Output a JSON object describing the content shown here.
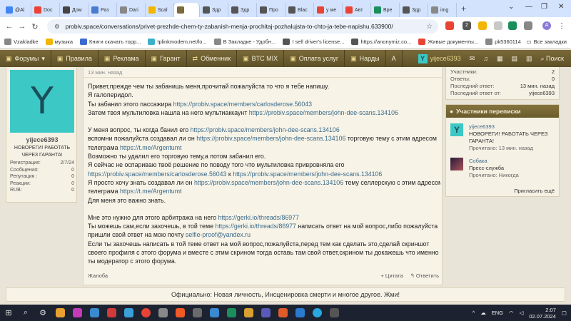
{
  "browser": {
    "tabs": [
      {
        "label": "@Al",
        "color": "#4285f4"
      },
      {
        "label": "Doc",
        "color": "#e94335"
      },
      {
        "label": "Дом",
        "color": "#444444"
      },
      {
        "label": "Раз",
        "color": "#4a7bd0"
      },
      {
        "label": "Dari",
        "color": "#888888"
      },
      {
        "label": "Scal",
        "color": "#f2b600"
      },
      {
        "label": "",
        "color": "#7a6a3a",
        "active": true
      },
      {
        "label": "Здр",
        "color": "#555555"
      },
      {
        "label": "Здр",
        "color": "#555555"
      },
      {
        "label": "Про",
        "color": "#555555"
      },
      {
        "label": "Blac",
        "color": "#555555"
      },
      {
        "label": "у ме",
        "color": "#e94335"
      },
      {
        "label": "Авт",
        "color": "#e94335"
      },
      {
        "label": "Вре",
        "color": "#1a8f5c"
      },
      {
        "label": "Здр",
        "color": "#555555"
      },
      {
        "label": "img",
        "color": "#888888"
      }
    ],
    "new_tab": "+",
    "url": "probiv.space/conversations/privet-prezhde-chem-ty-zabanish-menja-prochitaj-pozhalujsta-to-chto-ja-tebe-napishu.633900/",
    "extension_badge": "2",
    "profile_letter": "A",
    "bookmarks": [
      {
        "label": "Vzakladke",
        "color": "#888888"
      },
      {
        "label": "музыка",
        "color": "#f2b600"
      },
      {
        "label": "Книги скачать торр...",
        "color": "#3a6ad0"
      },
      {
        "label": "tplinkmodem.net/lo...",
        "color": "#3cb0c8"
      },
      {
        "label": "В Закладке - Удобн...",
        "color": "#888888"
      },
      {
        "label": "I sell driver's license...",
        "color": "#555555"
      },
      {
        "label": "https://anonymiz.co...",
        "color": "#555555"
      },
      {
        "label": "Живые документы...",
        "color": "#e94335"
      },
      {
        "label": "pk5360114",
        "color": "#888888"
      }
    ],
    "all_bookmarks": "Все закладки"
  },
  "forum_nav": {
    "items": [
      {
        "icon": "▣",
        "label": "Форумы",
        "caret": "▾"
      },
      {
        "icon": "▣",
        "label": "Правила"
      },
      {
        "icon": "▣",
        "label": "Реклама"
      },
      {
        "icon": "▣",
        "label": "Гарант"
      },
      {
        "icon": "⇄",
        "label": "Обменник"
      },
      {
        "icon": "▣",
        "label": "BTC MIX"
      },
      {
        "icon": "▣",
        "label": "Оплата услуг"
      },
      {
        "icon": "▣",
        "label": "Нарды"
      },
      {
        "icon": "",
        "label": "А"
      }
    ],
    "username": "yijece6393",
    "search": "Поиск"
  },
  "user": {
    "avatar_letter": "Y",
    "name": "yijece6393",
    "title": "НОВОРЕГИ! РАБОТАТЬ ЧЕРЕЗ ГАРАНТА!",
    "stats": [
      {
        "label": "Регистрация:",
        "value": "2/7/24"
      },
      {
        "label": "Сообщения:",
        "value": "0"
      },
      {
        "label": "Репутация :",
        "value": "0"
      },
      {
        "label": "Реакции:",
        "value": "0"
      },
      {
        "label": "RUB:",
        "value": "0"
      }
    ]
  },
  "message": {
    "time": "13 мин. назад",
    "lines": [
      {
        "t": "Привет,прежде чем ты забанишь меня,прочитай пожалуйста то что я тебе напишу."
      },
      {
        "t": "Я галоперидол."
      },
      {
        "t": "Ты забанил этого пассажира ",
        "link": "https://probiv.space/members/carlosderose.56043"
      },
      {
        "t": "Затем твоя мультиловка нашла на него мультиаккаунт ",
        "link": "https://probiv.space/members/john-dee-scans.134106"
      },
      {
        "gap": true
      },
      {
        "t": "У меня вопрос, ты когда банил его ",
        "link": "https://probiv.space/members/john-dee-scans.134106"
      },
      {
        "t": "вспомни пожалуйста создавал ли он ",
        "link": "https://probiv.space/members/john-dee-scans.134106",
        "after": " торговую тему с этим адресом"
      },
      {
        "t": "телеграма ",
        "link": "https://t.me/Argentumt"
      },
      {
        "t": "Возможно ты удалил его торговую тему,а потом забанил его."
      },
      {
        "t": "Я сейчас не оспариваю твоё решение по поводу того что мультиловка привровняла его"
      },
      {
        "link": "https://probiv.space/members/carlosderose.56043",
        "t2": " к ",
        "link2": "https://probiv.space/members/john-dee-scans.134106"
      },
      {
        "t": "Я просто хочу знать создавал ли он ",
        "link": "https://probiv.space/members/john-dee-scans.134106",
        "after": " тему селлерскую с этим адресом"
      },
      {
        "t": "телеграма ",
        "link": "https://t.me/Argentumt"
      },
      {
        "t": "Для меня это важно знать."
      },
      {
        "gap": true
      },
      {
        "t": "Мне это нужно для этого арбитража на него ",
        "link": "https://gerki.io/threads/86977"
      },
      {
        "t": "Ты можешь сам,если захочешь, в той теме ",
        "link": "https://gerki.io/threads/86977",
        "after": " написать ответ на мой вопрос,либо пожалуйста"
      },
      {
        "t": "пришли свой ответ на мою почту ",
        "link": "selfie-proof@yandex.ru"
      },
      {
        "t": "Если ты захочешь написать в той теме ответ на мой вопрос,пожалуйста,перед тем как сделать это,сделай скриншот"
      },
      {
        "t": "своего профиля с этого форума и вместе с этим скрином тогда оставь там свой ответ,скрином ты докажешь что именно"
      },
      {
        "t": "ты модератор с этого форума."
      }
    ],
    "report": "Жалоба",
    "quote": "+ Цитата",
    "reply": "↰ Ответить"
  },
  "thread_info": [
    {
      "label": "Участники:",
      "value": "2"
    },
    {
      "label": "Ответы:",
      "value": "0"
    },
    {
      "label": "Последний ответ:",
      "value": "13 мин. назад"
    },
    {
      "label": "Последний ответ от:",
      "value": "yijece6393"
    }
  ],
  "participants": {
    "title": "Участники переписки",
    "list": [
      {
        "name": "yijece6393",
        "role": "НОВОРЕГИ! РАБОТАТЬ ЧЕРЕЗ ГАРАНТА!",
        "status": "Прочитано: 13 мин. назад",
        "avatar_letter": "Y"
      },
      {
        "name": "Собака",
        "role": "Пресс-служба",
        "status": "Прочитано: Никогда",
        "avatar_letter": ""
      }
    ],
    "invite": "Пригласить ещё"
  },
  "notice": "Официально: Новая личность, Инсценировка смерти и многое другое. Жми!",
  "taskbar": {
    "lang": "ENG",
    "time": "2:07",
    "date": "02.07.2024"
  },
  "colors": {
    "forum_brown": "#6a5b2c",
    "avatar_teal": "#3cc8c4",
    "link_blue": "#3a6a8a"
  }
}
